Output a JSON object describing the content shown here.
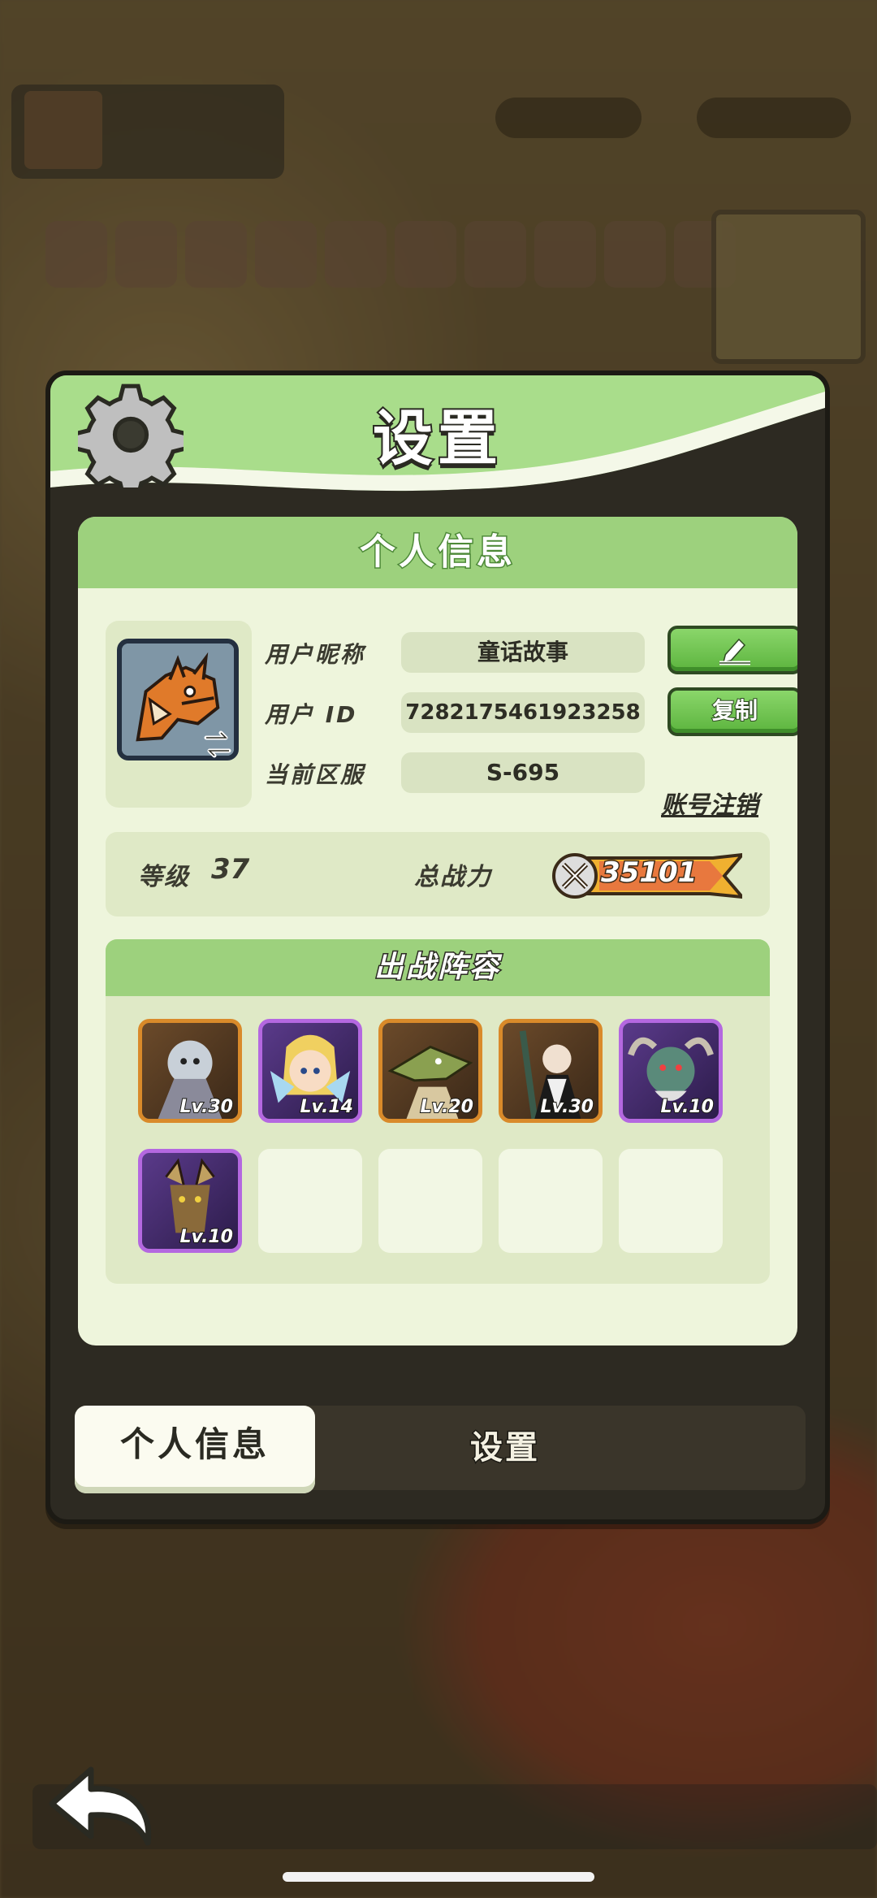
{
  "dialog": {
    "title": "设置",
    "gear_icon": "gear-icon"
  },
  "personal_info": {
    "heading": "个人信息",
    "nickname_label": "用户昵称",
    "nickname": "童话故事",
    "edit_icon": "pencil-icon",
    "id_label": "用户 ID",
    "user_id": "7282175461923258",
    "copy_label": "复制",
    "server_label": "当前区服",
    "server": "S-695",
    "cancel_account_label": "账号注销"
  },
  "stats": {
    "level_label": "等级",
    "level": "37",
    "power_label": "总战力",
    "power": "35101"
  },
  "lineup": {
    "heading": "出战阵容",
    "slots": [
      {
        "level": "Lv.30",
        "rarity": "legendary"
      },
      {
        "level": "Lv.14",
        "rarity": "epic"
      },
      {
        "level": "Lv.20",
        "rarity": "legendary"
      },
      {
        "level": "Lv.30",
        "rarity": "legendary"
      },
      {
        "level": "Lv.10",
        "rarity": "epic"
      },
      {
        "level": "Lv.10",
        "rarity": "epic"
      },
      {
        "level": "",
        "rarity": "empty"
      },
      {
        "level": "",
        "rarity": "empty"
      },
      {
        "level": "",
        "rarity": "empty"
      },
      {
        "level": "",
        "rarity": "empty"
      }
    ]
  },
  "tabs": {
    "active": "个人信息",
    "inactive": "设置"
  },
  "colors": {
    "header_green": "#9dd17d",
    "button_green": "#5cb43e",
    "legendary_border": "#d98a2a",
    "epic_border": "#b468e0"
  }
}
